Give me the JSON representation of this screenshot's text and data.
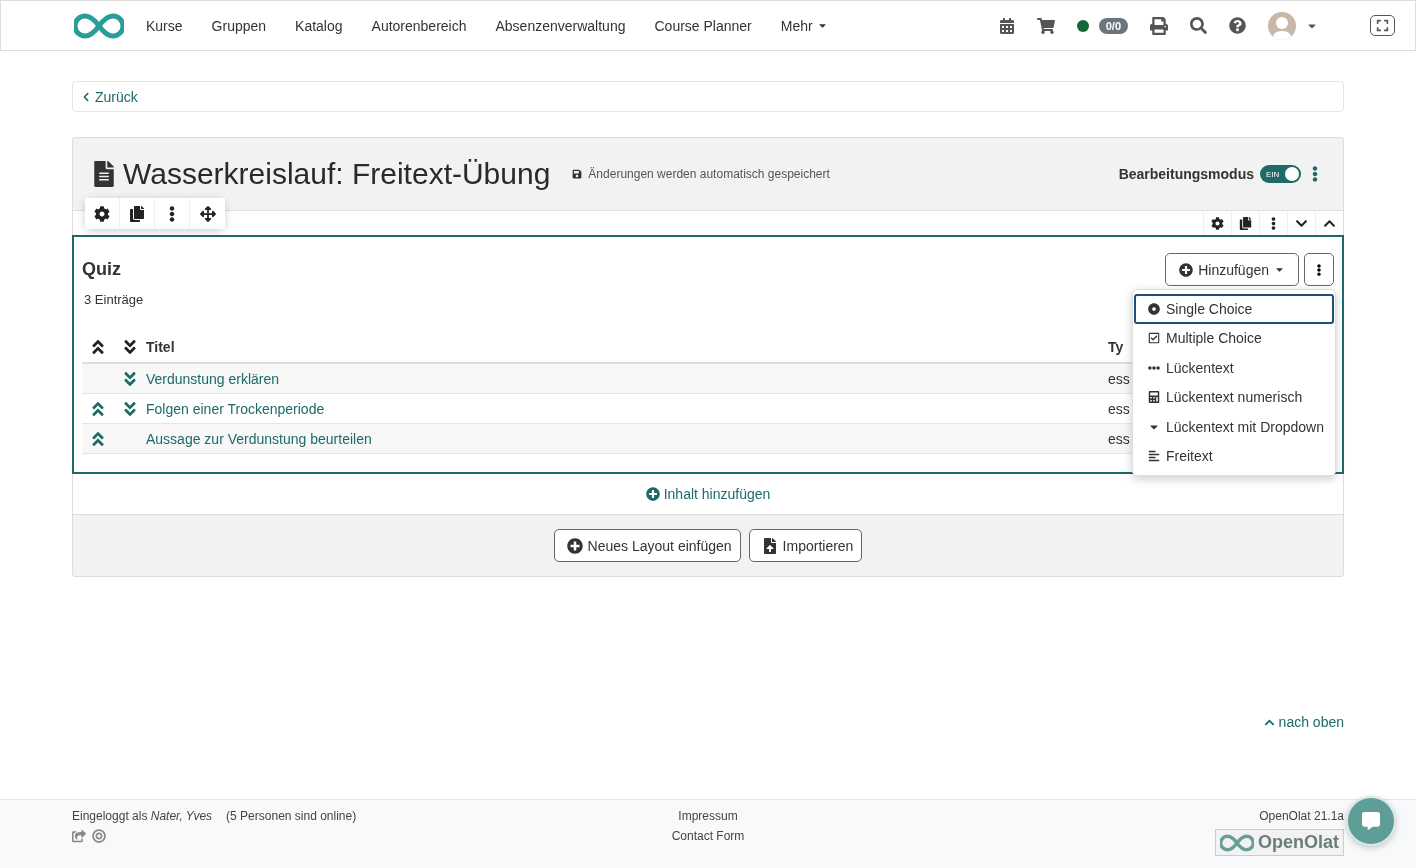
{
  "nav": {
    "items": [
      {
        "label": "Kurse"
      },
      {
        "label": "Gruppen"
      },
      {
        "label": "Katalog"
      },
      {
        "label": "Autorenbereich"
      },
      {
        "label": "Absenzenverwaltung"
      },
      {
        "label": "Course Planner"
      }
    ],
    "more": "Mehr",
    "status_online": true,
    "badge": "0/0"
  },
  "back": "Zurück",
  "page": {
    "title": "Wasserkreislauf: Freitext-Übung",
    "save_note": "Änderungen werden automatisch gespeichert",
    "edit_mode": {
      "label": "Bearbeitungsmodus",
      "switch_label": "EIN",
      "on": true
    }
  },
  "quiz": {
    "title": "Quiz",
    "count": "3 Einträge",
    "add_button": "Hinzufügen",
    "columns": [
      "Titel",
      "Ty"
    ],
    "rows": [
      {
        "title": "Verdunstung erklären",
        "type": "ess",
        "can_move_up": false,
        "can_move_down": true
      },
      {
        "title": "Folgen einer Trockenperiode",
        "type": "ess",
        "can_move_up": true,
        "can_move_down": true
      },
      {
        "title": "Aussage zur Verdunstung beurteilen",
        "type": "ess",
        "can_move_up": true,
        "can_move_down": false
      }
    ],
    "menu": [
      {
        "label": "Single Choice",
        "kind": "single",
        "selected": true
      },
      {
        "label": "Multiple Choice",
        "kind": "multiple",
        "selected": false
      },
      {
        "label": "Lückentext",
        "kind": "gap",
        "selected": false
      },
      {
        "label": "Lückentext numerisch",
        "kind": "numeric",
        "selected": false
      },
      {
        "label": "Lückentext mit Dropdown",
        "kind": "dropdown",
        "selected": false
      },
      {
        "label": "Freitext",
        "kind": "essay",
        "selected": false
      }
    ]
  },
  "add_content": "Inhalt hinzufügen",
  "buttons": [
    {
      "label": "Neues Layout einfügen",
      "kind": "add"
    },
    {
      "label": "Importieren",
      "kind": "import"
    }
  ],
  "to_top": "nach oben",
  "footer": {
    "logged_in": "Eingeloggt als *Nater, Yves*",
    "online": "(5 Personen sind online)",
    "links": [
      "Impressum",
      "Contact Form"
    ],
    "version": "OpenOlat 21.1a",
    "logo": "OpenOlat"
  }
}
